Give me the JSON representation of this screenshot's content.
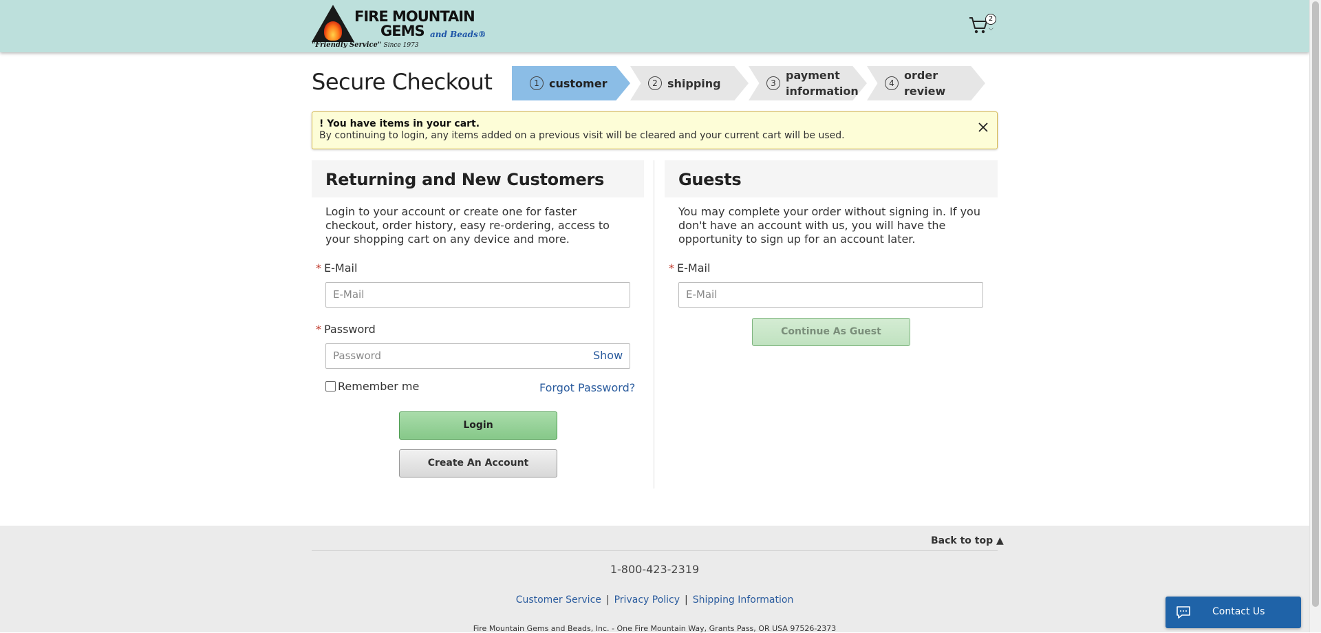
{
  "header": {
    "brand_line1": "FIRE MOUNTAIN",
    "brand_line2": "GEMS",
    "brand_line2b": "and Beads®",
    "tagline": "\"Friendly Service\"",
    "tagline_since": "Since 1973",
    "cart_count": "2"
  },
  "page_title": "Secure Checkout",
  "steps": [
    {
      "num": "1",
      "label": "customer",
      "active": true
    },
    {
      "num": "2",
      "label": "shipping"
    },
    {
      "num": "3",
      "label": "payment information"
    },
    {
      "num": "4",
      "label": "order review"
    }
  ],
  "alert": {
    "title": "! You have items in your cart.",
    "message": "By continuing to login, any items added on a previous visit will be cleared and your current cart will be used."
  },
  "returning": {
    "heading": "Returning and New Customers",
    "description": "Login to your account or create one for faster checkout, order history, easy re-ordering, access to your shopping cart on any device and more.",
    "email_label": "E-Mail",
    "email_placeholder": "E-Mail",
    "password_label": "Password",
    "password_placeholder": "Password",
    "show_label": "Show",
    "remember_label": "Remember me",
    "forgot_label": "Forgot Password?",
    "login_label": "Login",
    "create_label": "Create An Account"
  },
  "guests": {
    "heading": "Guests",
    "description": "You may complete your order without signing in. If you don't have an account with us, you will have the opportunity to sign up for an account later.",
    "email_label": "E-Mail",
    "email_placeholder": "E-Mail",
    "continue_label": "Continue As Guest"
  },
  "footer": {
    "back_to_top": "Back to top",
    "phone": "1-800-423-2319",
    "links": [
      "Customer Service",
      "Privacy Policy",
      "Shipping Information"
    ],
    "address": "Fire Mountain Gems and Beads, Inc. - One Fire Mountain Way, Grants Pass, OR USA 97526-2373"
  },
  "contact_label": "Contact Us"
}
